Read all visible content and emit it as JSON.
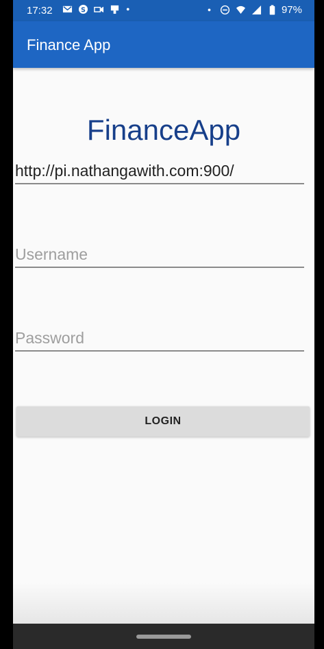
{
  "status_bar": {
    "time": "17:32",
    "battery": "97%",
    "left_icons": [
      "gmail-icon",
      "skype-icon",
      "video-icon",
      "notification-icon",
      "dot-icon"
    ],
    "right_icons": [
      "dot-icon",
      "do-not-disturb-icon",
      "wifi-icon",
      "signal-icon",
      "battery-icon"
    ]
  },
  "app_bar": {
    "title": "Finance App",
    "color": "#1e66c3"
  },
  "main": {
    "heading": "FinanceApp",
    "url_value": "http://pi.nathangawith.com:900/",
    "username_placeholder": "Username",
    "password_placeholder": "Password",
    "login_label": "LOGIN"
  }
}
